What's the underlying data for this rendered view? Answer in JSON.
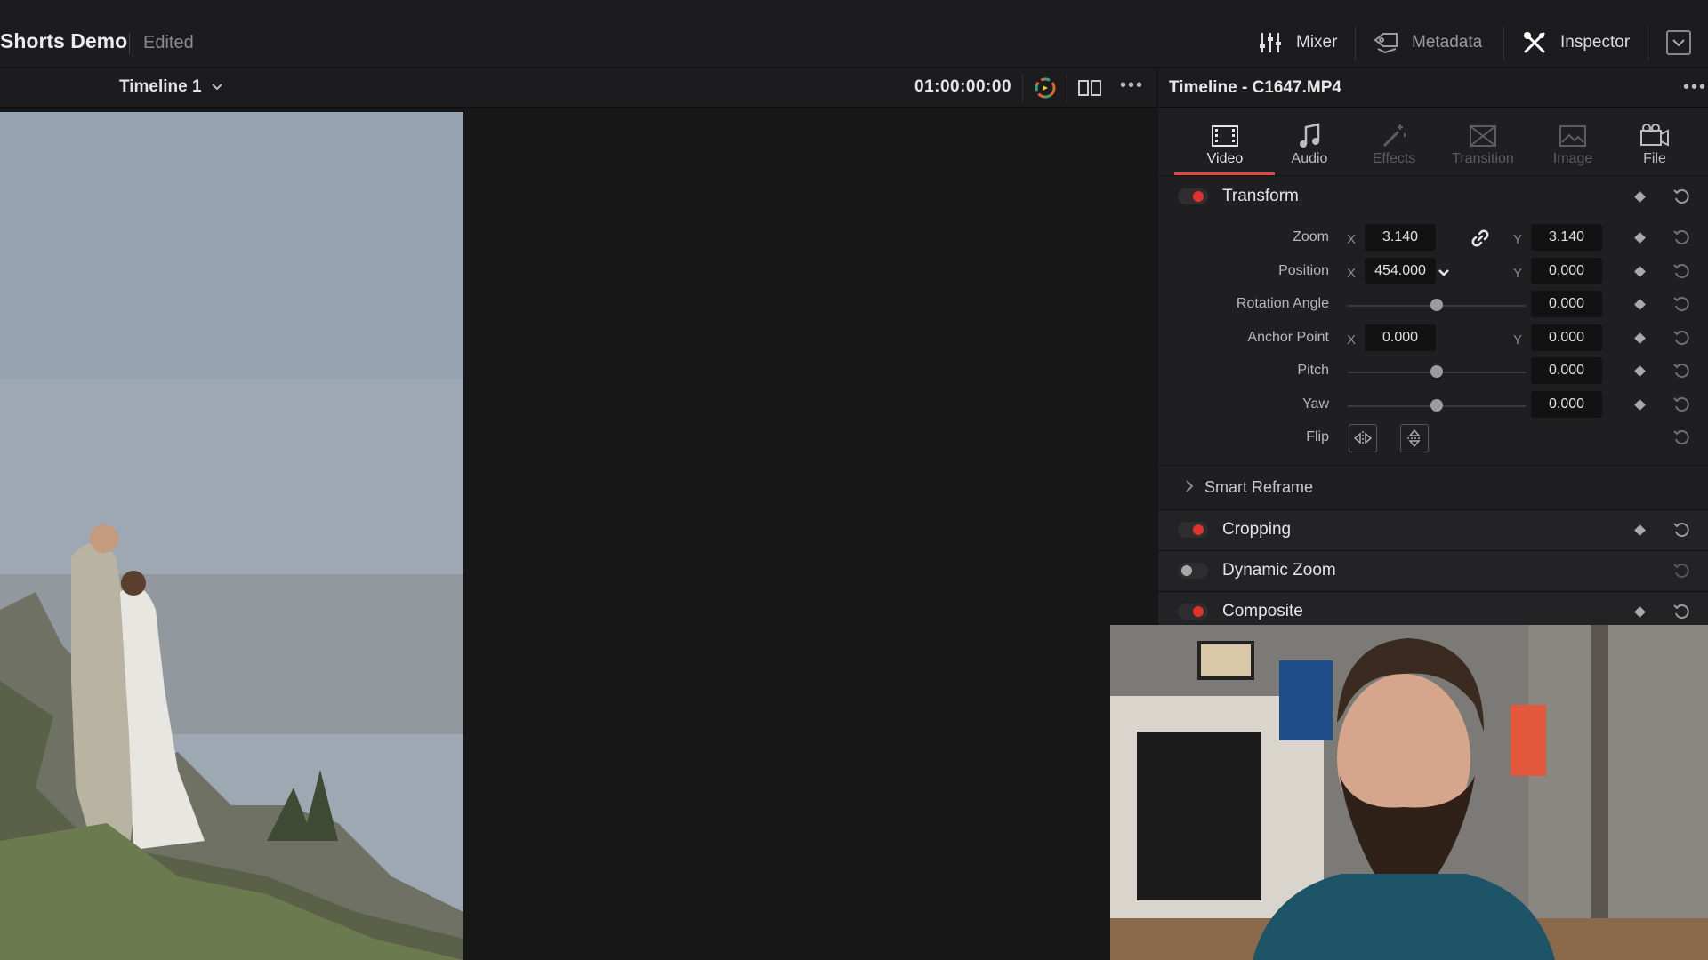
{
  "header": {
    "project_title": "Shorts Demo",
    "project_status": "Edited",
    "mixer_label": "Mixer",
    "metadata_label": "Metadata",
    "inspector_label": "Inspector"
  },
  "viewer": {
    "timeline_name": "Timeline 1",
    "timecode": "01:00:00:00"
  },
  "inspector": {
    "title": "Timeline - C1647.MP4",
    "tabs": [
      {
        "label": "Video",
        "icon": "film-icon",
        "state": "active"
      },
      {
        "label": "Audio",
        "icon": "music-note-icon",
        "state": "enabled"
      },
      {
        "label": "Effects",
        "icon": "magic-wand-icon",
        "state": "disabled"
      },
      {
        "label": "Transition",
        "icon": "transition-icon",
        "state": "disabled"
      },
      {
        "label": "Image",
        "icon": "image-icon",
        "state": "disabled"
      },
      {
        "label": "File",
        "icon": "camera-icon",
        "state": "enabled"
      }
    ],
    "transform": {
      "label": "Transform",
      "enabled": true,
      "zoom": {
        "label": "Zoom",
        "x": "3.140",
        "y": "3.140"
      },
      "position": {
        "label": "Position",
        "x": "454.000",
        "y": "0.000"
      },
      "rotation": {
        "label": "Rotation Angle",
        "value": "0.000",
        "slider": 0.5
      },
      "anchor": {
        "label": "Anchor Point",
        "x": "0.000",
        "y": "0.000"
      },
      "pitch": {
        "label": "Pitch",
        "value": "0.000",
        "slider": 0.5
      },
      "yaw": {
        "label": "Yaw",
        "value": "0.000",
        "slider": 0.5
      },
      "flip": {
        "label": "Flip"
      },
      "axis_x": "X",
      "axis_y": "Y"
    },
    "smart_reframe": {
      "label": "Smart Reframe"
    },
    "cropping": {
      "label": "Cropping",
      "enabled": true
    },
    "dynamic_zoom": {
      "label": "Dynamic Zoom",
      "enabled": false
    },
    "composite": {
      "label": "Composite",
      "enabled": true
    }
  },
  "colors": {
    "accent_red": "#e0322b",
    "background": "#161616",
    "panel": "#1f1f21"
  }
}
